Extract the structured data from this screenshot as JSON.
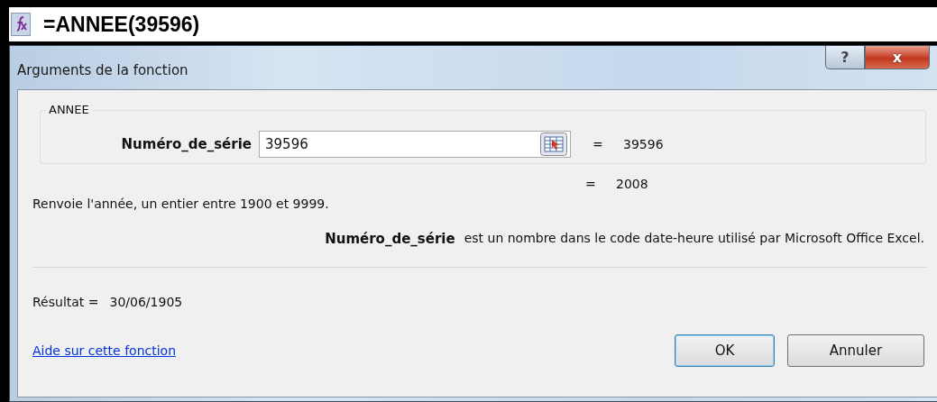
{
  "formula_bar": {
    "formula": "=ANNEE(39596)"
  },
  "dialog": {
    "title": "Arguments de la fonction",
    "help_button": "?",
    "close_button": "x"
  },
  "function_group": {
    "title": "ANNEE",
    "arguments": [
      {
        "label": "Numéro_de_série",
        "value": "39596",
        "equals": "=",
        "evaluated": "39596"
      }
    ]
  },
  "function_value": {
    "equals": "=",
    "value": "2008"
  },
  "description": "Renvoie l'année, un entier entre 1900 et 9999.",
  "argument_help": {
    "name": "Numéro_de_série",
    "text": "est un nombre dans le code date-heure utilisé par Microsoft Office Excel."
  },
  "result": {
    "label": "Résultat =",
    "value": "30/06/1905"
  },
  "help_link": "Aide sur cette fonction",
  "buttons": [
    {
      "label": "OK",
      "default": true
    },
    {
      "label": "Annuler",
      "default": false
    }
  ]
}
